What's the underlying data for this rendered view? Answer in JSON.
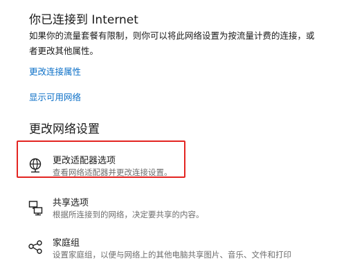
{
  "status": {
    "title": "你已连接到 Internet",
    "description": "如果你的流量套餐有限制，则你可以将此网络设置为按流量计费的连接，或者更改其他属性。"
  },
  "links": {
    "change_connection_properties": "更改连接属性",
    "show_available_networks": "显示可用网络"
  },
  "section": {
    "heading": "更改网络设置"
  },
  "options": [
    {
      "title": "更改适配器选项",
      "description": "查看网络适配器并更改连接设置。",
      "icon": "network-adapter-icon"
    },
    {
      "title": "共享选项",
      "description": "根据所连接到的网络，决定要共享的内容。",
      "icon": "sharing-icon"
    },
    {
      "title": "家庭组",
      "description": "设置家庭组，以便与网络上的其他电脑共享图片、音乐、文件和打印",
      "icon": "homegroup-icon"
    }
  ],
  "colors": {
    "link": "#0b6fc7",
    "highlight": "#e32320",
    "secondary_text": "#6d6d6d"
  }
}
